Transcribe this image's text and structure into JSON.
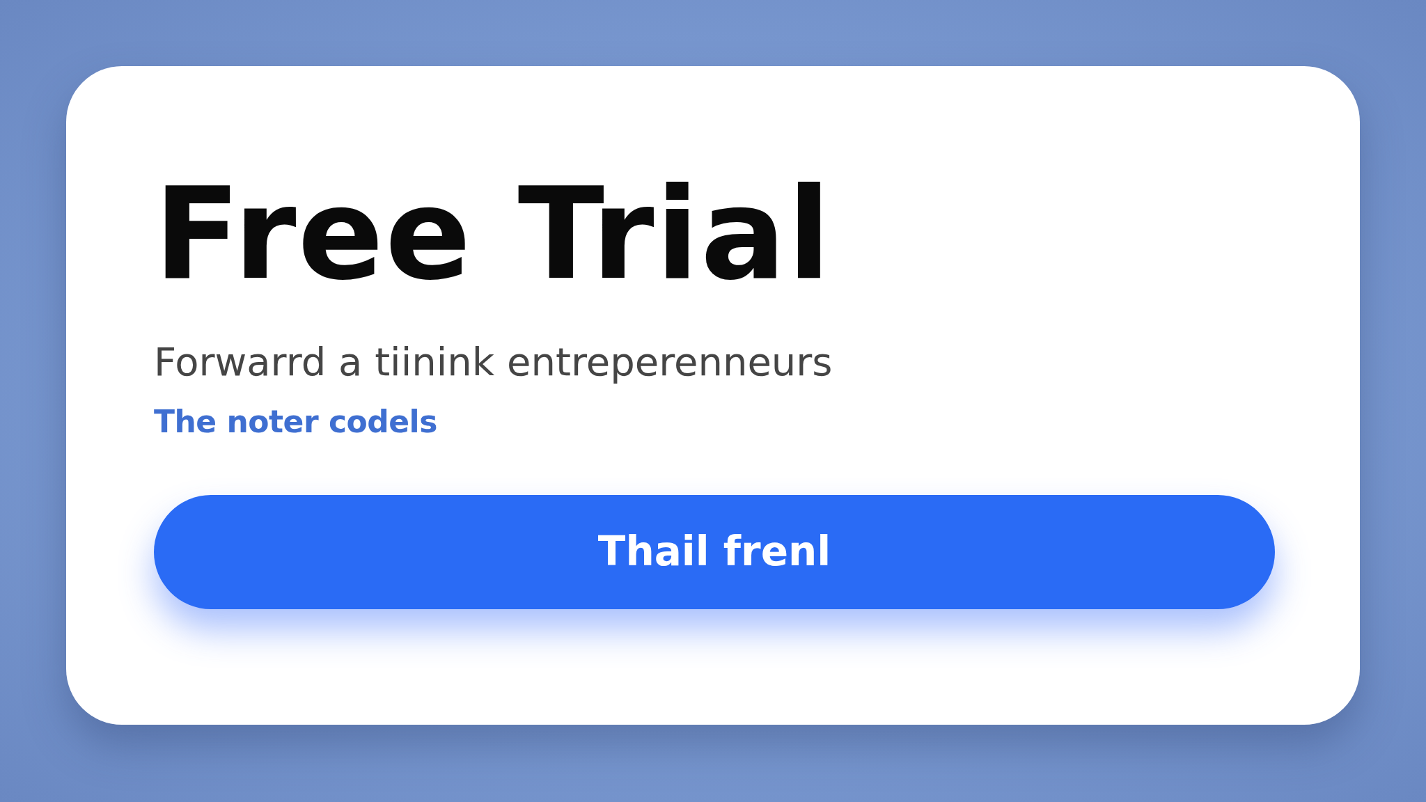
{
  "card": {
    "title": "Free Trial",
    "subtitle": "Forwarrd a tiinink entreperenneurs",
    "link": "The noter codels",
    "button": "Thail frenl"
  }
}
